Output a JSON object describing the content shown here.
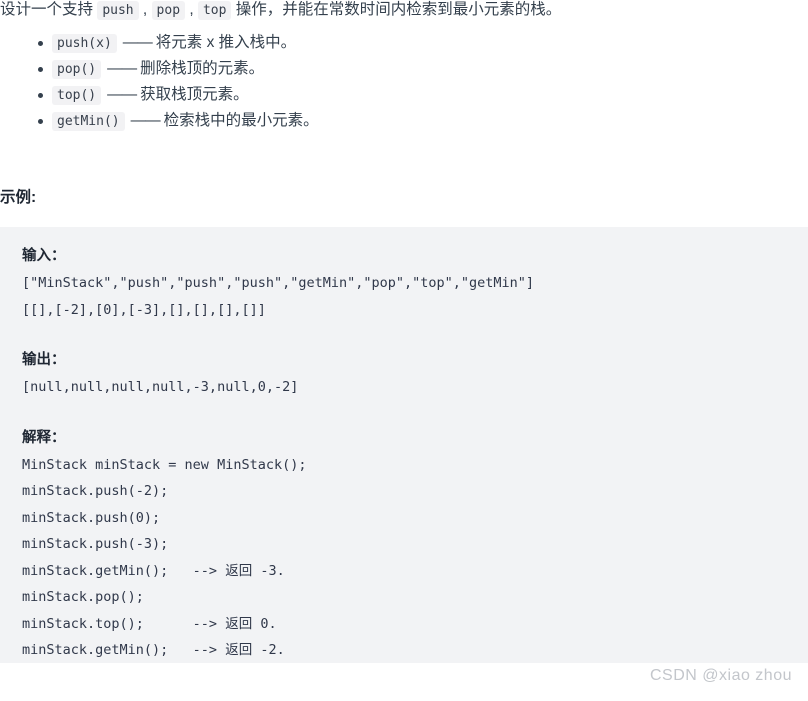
{
  "intro": {
    "before": "设计一个支持 ",
    "code1": "push",
    "sep1": " , ",
    "code2": "pop",
    "sep2": " , ",
    "code3": "top",
    "after": " 操作，并能在常数时间内检索到最小元素的栈。"
  },
  "operations": [
    {
      "code": "push(x)",
      "dash": "——",
      "desc": "将元素 x 推入栈中。"
    },
    {
      "code": "pop()",
      "dash": "——",
      "desc": "删除栈顶的元素。"
    },
    {
      "code": "top()",
      "dash": "——",
      "desc": "获取栈顶元素。"
    },
    {
      "code": "getMin()",
      "dash": "——",
      "desc": "检索栈中的最小元素。"
    }
  ],
  "example": {
    "heading": "示例:",
    "input_label": "输入：",
    "input_lines": [
      "[\"MinStack\",\"push\",\"push\",\"push\",\"getMin\",\"pop\",\"top\",\"getMin\"]",
      "[[],[-2],[0],[-3],[],[],[],[]]"
    ],
    "output_label": "输出：",
    "output_lines": [
      "[null,null,null,null,-3,null,0,-2]"
    ],
    "explain_label": "解释：",
    "explain_lines": [
      "MinStack minStack = new MinStack();",
      "minStack.push(-2);",
      "minStack.push(0);",
      "minStack.push(-3);",
      "minStack.getMin();   --> 返回 -3.",
      "minStack.pop();",
      "minStack.top();      --> 返回 0.",
      "minStack.getMin();   --> 返回 -2."
    ]
  },
  "watermark": "CSDN @xiao zhou",
  "colors": {
    "page_background": "#ffffff",
    "code_block_background": "#f2f3f5",
    "inline_chip_background": "#f2f2f4",
    "text": "#34404d",
    "code_text": "#30384a",
    "watermark": "#c3c6cb"
  }
}
